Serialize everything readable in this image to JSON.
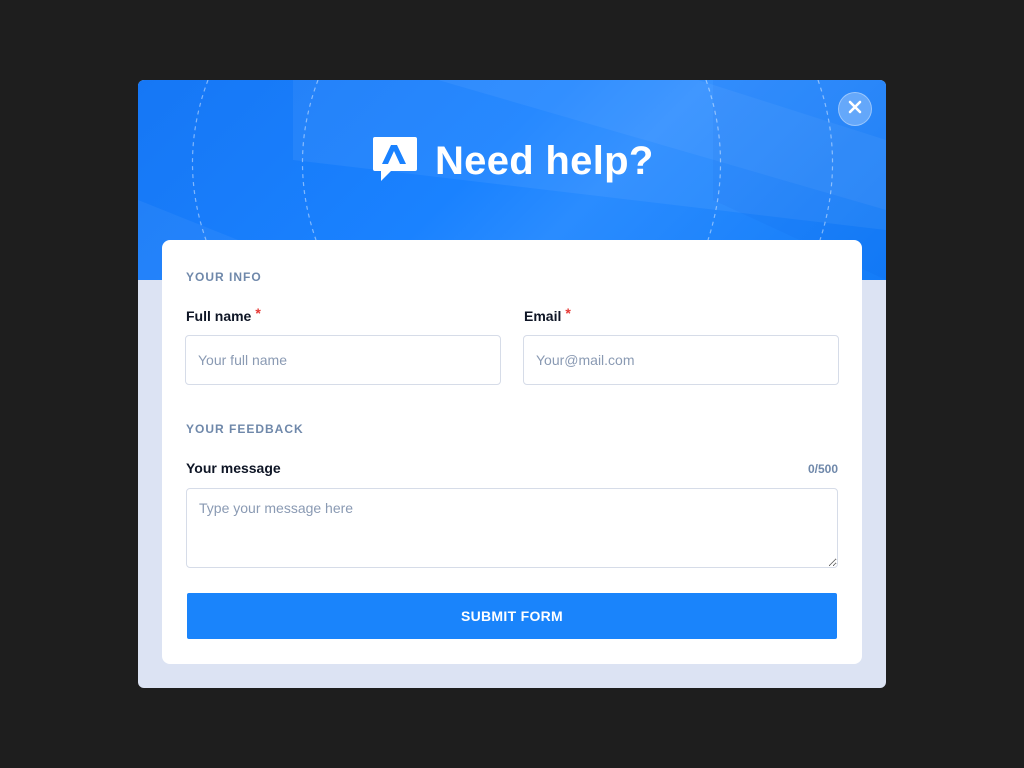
{
  "modal": {
    "title": "Need help?",
    "close_icon": "close-icon",
    "logo_icon": "chat-bubble-logo-icon"
  },
  "form": {
    "info_section": "YOUR  INFO",
    "full_name": {
      "label": "Full name",
      "required_mark": "*",
      "placeholder": "Your full name",
      "value": ""
    },
    "email": {
      "label": "Email",
      "required_mark": "*",
      "placeholder": "Your@mail.com",
      "value": ""
    },
    "feedback_section": "YOUR FEEDBACK",
    "message": {
      "label": "Your message",
      "counter": "0/500",
      "placeholder": "Type your message here",
      "value": ""
    },
    "submit_label": "SUBMIT FORM"
  },
  "colors": {
    "backdrop": "#1e1e1e",
    "hero_blue": "#1a82ff",
    "button_blue": "#1a84fb",
    "required_red": "#e53935",
    "section_label": "#6f88aa"
  }
}
